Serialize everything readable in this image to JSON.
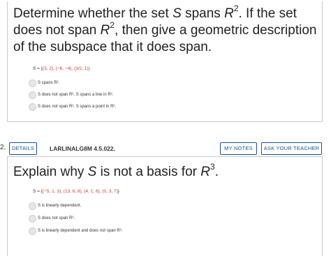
{
  "q1": {
    "text_a": "Determine whether the set ",
    "text_var": "S",
    "text_b": " spans ",
    "text_r": "R",
    "text_r_exp": "2",
    "text_c": ". If the set does not span ",
    "text_r2": "R",
    "text_r2_exp": "2",
    "text_d": ", then give a geometric description of the subspace that it does span.",
    "set_prefix": "S = {",
    "set_values": "(3, 2), (−6, −4), (",
    "set_frac": "3/2",
    "set_tail": ", 1)}",
    "options": [
      {
        "label": "S spans R²."
      },
      {
        "label": "S does not span R². S spans a line in R²."
      },
      {
        "label": "S does not span R². S spans a point in R²."
      }
    ]
  },
  "header": {
    "question_number": "2.",
    "details_label": "DETAILS",
    "question_code": "LARLINALG8M 4.5.022.",
    "mynotes_label": "MY NOTES",
    "ask_label": "ASK YOUR TEACHER"
  },
  "q2": {
    "text_a": "Explain why ",
    "text_var": "S",
    "text_b": " is not a basis for ",
    "text_r": "R",
    "text_r_exp": "3",
    "text_c": ".",
    "set_prefix": "S = {",
    "set_values": "(−5, 1, 3), (13, 6, 8), (4, 1, 6), (0, 3, 7)",
    "set_suffix": "}",
    "options": [
      {
        "label": "S is linearly dependent."
      },
      {
        "label": "S does not span R³."
      },
      {
        "label": "S is linearly dependent and does not span R³."
      }
    ]
  }
}
